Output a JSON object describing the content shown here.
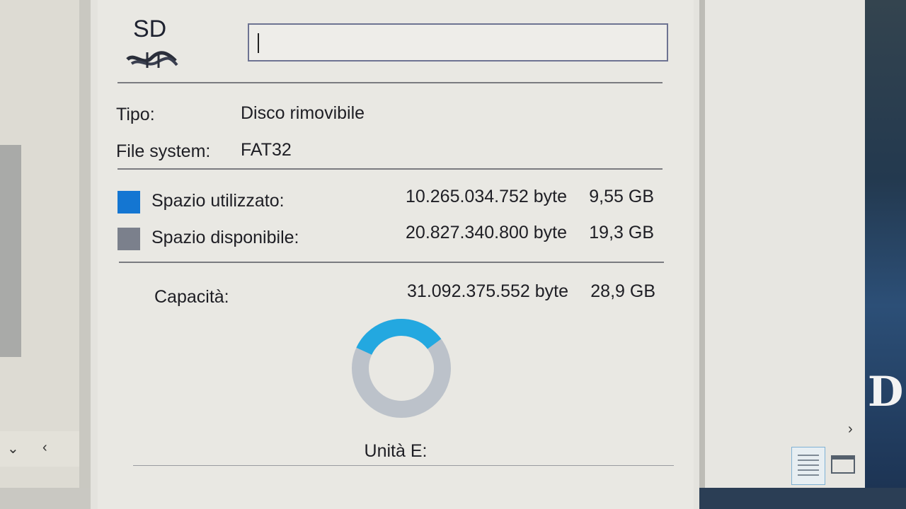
{
  "drive": {
    "icon_text": "SD",
    "name_value": "",
    "type_label": "Tipo:",
    "type_value": "Disco rimovibile",
    "fs_label": "File system:",
    "fs_value": "FAT32",
    "drive_label": "Unità E:"
  },
  "space": {
    "used": {
      "label": "Spazio utilizzato:",
      "bytes": "10.265.034.752 byte",
      "size": "9,55 GB",
      "color": "#1476d2"
    },
    "free": {
      "label": "Spazio disponibile:",
      "bytes": "20.827.340.800 byte",
      "size": "19,3 GB",
      "color": "#7b808c"
    },
    "capacity": {
      "label": "Capacità:",
      "bytes": "31.092.375.552 byte",
      "size": "28,9 GB"
    },
    "used_fraction": 0.33
  },
  "chart_colors": {
    "used": "#23a8e0",
    "free": "#bcc2ca"
  },
  "desktop_glyph": "D"
}
